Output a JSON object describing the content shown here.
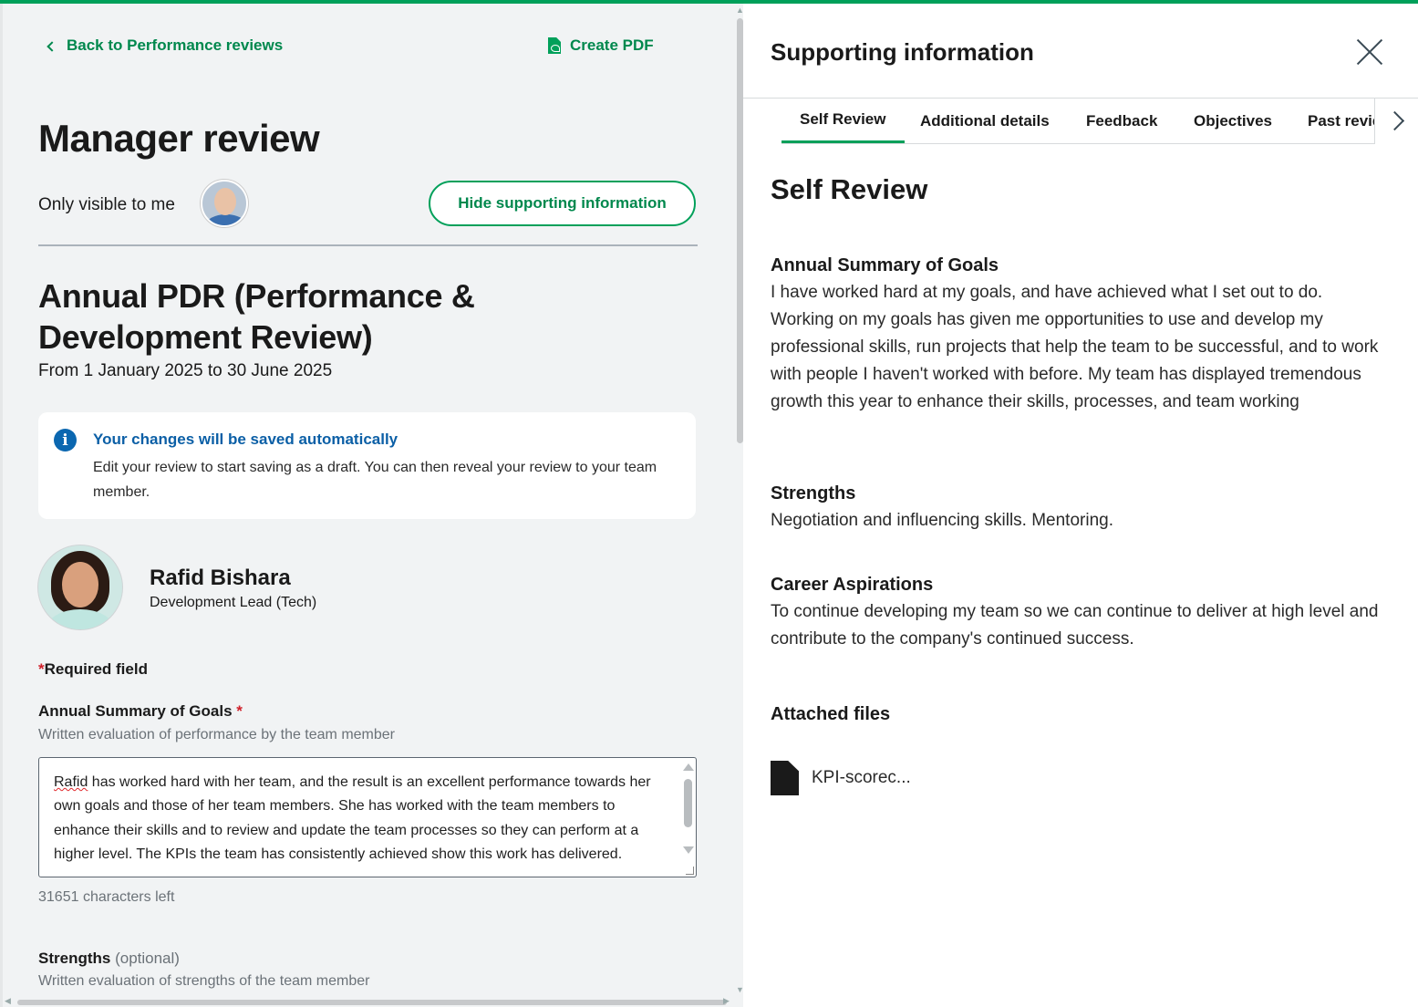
{
  "nav": {
    "back_label": "Back to Performance reviews",
    "pdf_label": "Create PDF"
  },
  "header": {
    "title": "Manager review",
    "visibility": "Only visible to me",
    "hide_button": "Hide supporting information"
  },
  "review": {
    "title": "Annual PDR (Performance & Development Review)",
    "date_range": "From 1 January 2025 to 30 June 2025"
  },
  "info": {
    "title": "Your changes will be saved automatically",
    "body": "Edit your review to start saving as a draft. You can then reveal your review to your team member."
  },
  "person": {
    "name": "Rafid Bishara",
    "role": "Development Lead (Tech)"
  },
  "form": {
    "required_star": "*",
    "required_note": "Required field",
    "field1_label": "Annual Summary of Goals",
    "field1_help": "Written evaluation of performance by the team member",
    "field1_value_first": "Rafid",
    "field1_value_rest": " has worked hard with her team, and the result is an excellent performance towards her own goals and those of her team members. She has worked with the team members to enhance their skills and to review and update the team processes so they can perform at a higher level. The KPIs the team has consistently achieved show this work has delivered.",
    "chars_left": "31651 characters left",
    "field2_label": "Strengths",
    "field2_optional": "(optional)",
    "field2_help": "Written evaluation of strengths of the team member"
  },
  "panel": {
    "title": "Supporting information",
    "tabs": [
      "Self Review",
      "Additional details",
      "Feedback",
      "Objectives",
      "Past reviews"
    ],
    "active_tab": "Self Review",
    "section_title": "Self Review",
    "goals_head": "Annual Summary of Goals",
    "goals_body": "I have worked hard at my goals, and have achieved what I set out to do. Working on my goals has given me opportunities to use and develop my professional skills, run projects that help the team to be successful, and to work with people I haven't worked with before. My team has displayed tremendous growth this year to enhance their skills, processes, and team working",
    "strengths_head": "Strengths",
    "strengths_body": "Negotiation and influencing skills. Mentoring.",
    "career_head": "Career Aspirations",
    "career_body": "To continue developing my team so we can continue to deliver at high level and contribute to the company's continued success.",
    "files_head": "Attached files",
    "file_name": "KPI-scorec..."
  },
  "colors": {
    "accent": "#00a05a",
    "accent_text": "#00884d",
    "info_blue": "#0b5fa6",
    "required": "#d0202a"
  },
  "icons": [
    "chevron-left-icon",
    "pdf-file-icon",
    "info-icon",
    "close-icon",
    "chevron-right-icon",
    "file-icon"
  ]
}
